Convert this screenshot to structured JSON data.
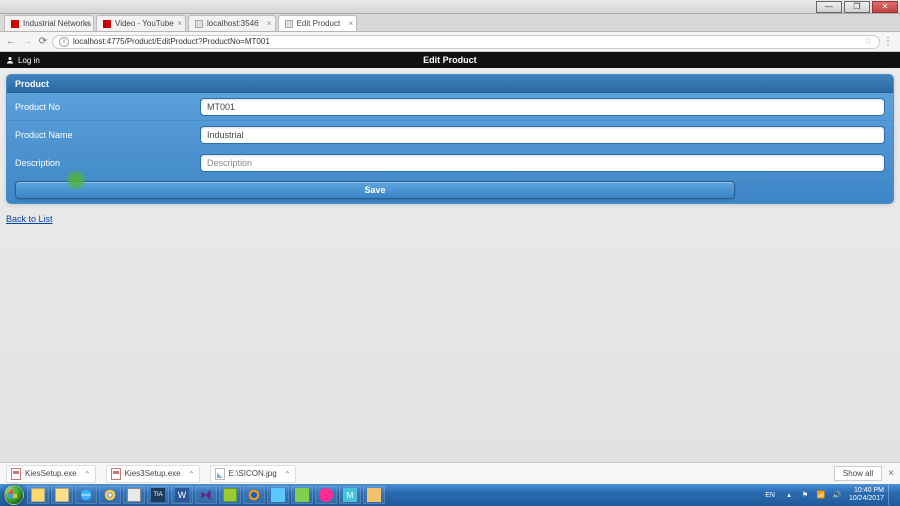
{
  "window": {
    "tabs": [
      {
        "label": "Industrial Networks - Yo"
      },
      {
        "label": "Video - YouTube"
      },
      {
        "label": "localhost:3546"
      },
      {
        "label": "Edit Product",
        "active": true
      }
    ],
    "url": "localhost:4775/Product/EditProduct?ProductNo=MT001"
  },
  "page": {
    "login_label": "Log in",
    "title": "Edit Product",
    "panel_title": "Product",
    "fields": {
      "product_no": {
        "label": "Product No",
        "value": "MT001"
      },
      "product_name": {
        "label": "Product Name",
        "value": "Industrial "
      },
      "description": {
        "label": "Description",
        "placeholder": "Description",
        "value": ""
      }
    },
    "save_label": "Save",
    "back_label": "Back to List"
  },
  "downloads": {
    "items": [
      {
        "name": "KiesSetup.exe",
        "kind": "exe"
      },
      {
        "name": "Kies3Setup.exe",
        "kind": "exe"
      },
      {
        "name": "SICON.jpg",
        "kind": "img",
        "drive": "E:\\"
      }
    ],
    "show_all": "Show all"
  },
  "tray": {
    "lang": "EN",
    "time": "10:40 PM",
    "date": "10/24/2017"
  }
}
